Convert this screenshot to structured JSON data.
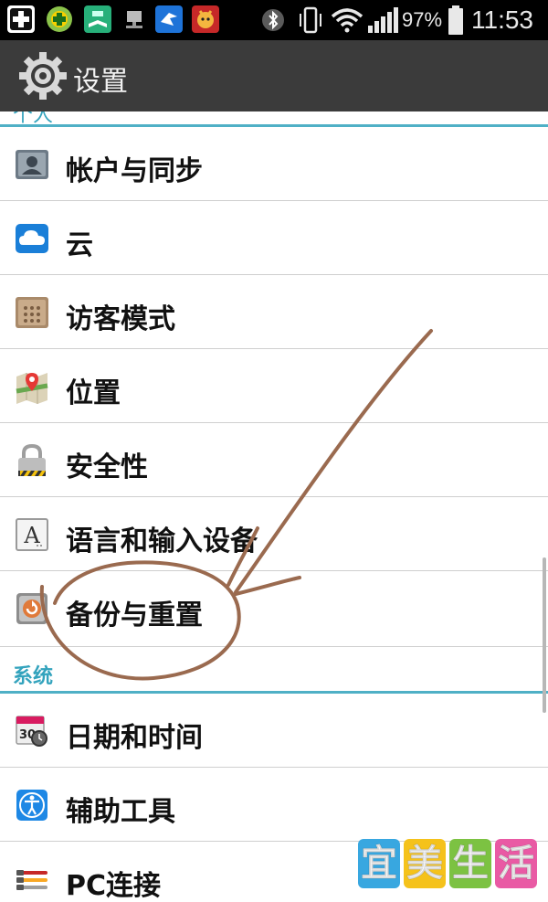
{
  "status_bar": {
    "battery_percent": "97%",
    "time": "11:53",
    "battery_level": 0.97,
    "notification_icons": [
      "medical-plus-icon",
      "game-controller-icon",
      "book-app-icon",
      "network-drive-icon",
      "bird-app-icon",
      "monkey-app-icon"
    ],
    "system_icons": [
      "bluetooth-icon",
      "vibrate-icon",
      "wifi-icon",
      "signal-icon",
      "battery-icon"
    ]
  },
  "action_bar": {
    "title": "设置",
    "icon": "settings-gear-icon"
  },
  "top_section_peek": "个人",
  "items_personal": [
    {
      "label": "帐户与同步",
      "icon": "account-sync-icon"
    },
    {
      "label": "云",
      "icon": "cloud-icon"
    },
    {
      "label": "访客模式",
      "icon": "guest-mode-icon"
    },
    {
      "label": "位置",
      "icon": "location-map-icon"
    },
    {
      "label": "安全性",
      "icon": "lock-icon"
    },
    {
      "label": "语言和输入设备",
      "icon": "language-a-icon"
    },
    {
      "label": "备份与重置",
      "icon": "backup-reset-icon"
    }
  ],
  "section_system": "系统",
  "items_system": [
    {
      "label": "日期和时间",
      "icon": "calendar-clock-icon"
    },
    {
      "label": "辅助工具",
      "icon": "accessibility-icon"
    },
    {
      "label": "PC连接",
      "icon": "pc-connection-icon"
    }
  ],
  "watermark": {
    "chars": [
      "宜",
      "美",
      "生",
      "活"
    ],
    "colors": [
      "#38a7e0",
      "#f5c21b",
      "#7cc242",
      "#e95aa4"
    ]
  },
  "colors": {
    "section_accent": "#33a3bd",
    "annotation_stroke": "#9a6a4f",
    "action_bar": "#3b3b3b"
  }
}
